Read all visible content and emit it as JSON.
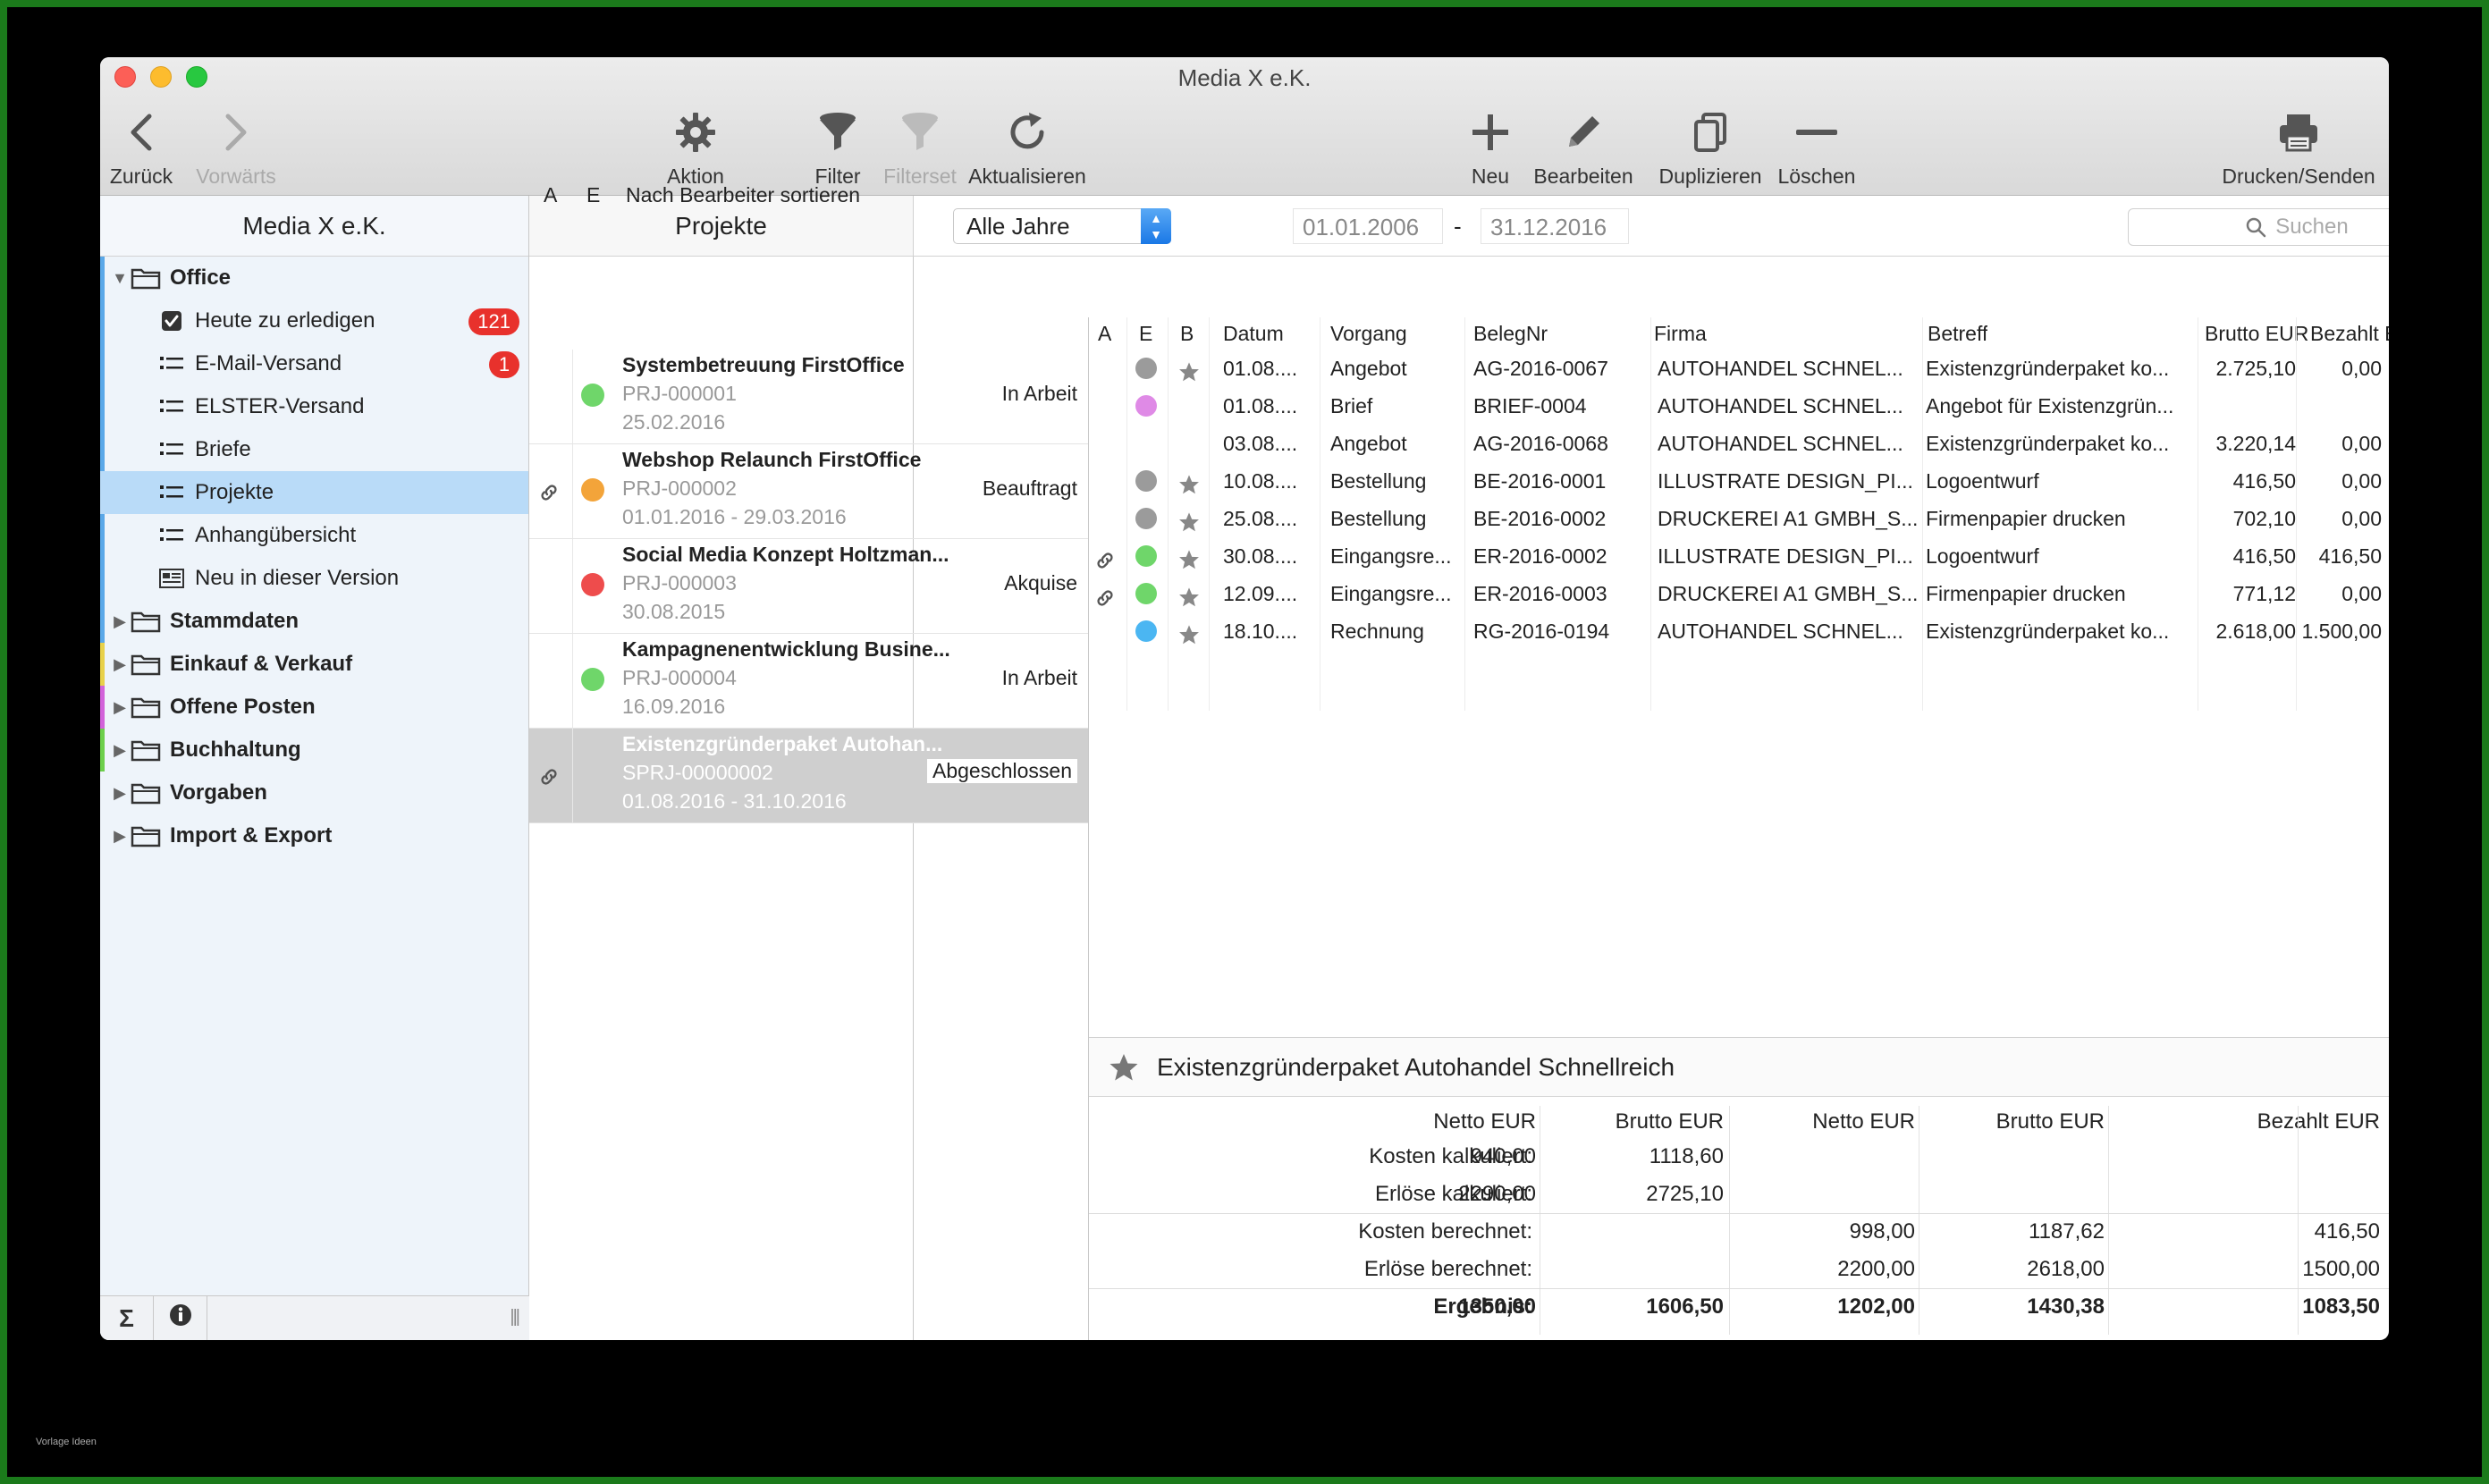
{
  "window": {
    "title": "Media X e.K."
  },
  "toolbar": {
    "back": "Zurück",
    "forward": "Vorwärts",
    "action": "Aktion",
    "filter": "Filter",
    "filterset": "Filterset",
    "refresh": "Aktualisieren",
    "new": "Neu",
    "edit": "Bearbeiten",
    "duplicate": "Duplizieren",
    "delete": "Löschen",
    "print": "Drucken/Senden"
  },
  "sidebar": {
    "title": "Media X e.K.",
    "office_label": "Office",
    "office_children": [
      {
        "label": "Heute zu erledigen",
        "icon": "checkbox-icon",
        "badge": "121"
      },
      {
        "label": "E-Mail-Versand",
        "icon": "list-icon",
        "badge": "1"
      },
      {
        "label": "ELSTER-Versand",
        "icon": "list-icon",
        "badge": ""
      },
      {
        "label": "Briefe",
        "icon": "list-icon",
        "badge": ""
      },
      {
        "label": "Projekte",
        "icon": "list-icon",
        "badge": ""
      },
      {
        "label": "Anhangübersicht",
        "icon": "list-icon",
        "badge": ""
      },
      {
        "label": "Neu in dieser Version",
        "icon": "newsletter-icon",
        "badge": ""
      }
    ],
    "folders": [
      {
        "label": "Stammdaten",
        "color": "#5aa8e8"
      },
      {
        "label": "Einkauf & Verkauf",
        "color": "#e8d14a"
      },
      {
        "label": "Offene Posten",
        "color": "#d262d9"
      },
      {
        "label": "Buchhaltung",
        "color": "#6ccf4b"
      },
      {
        "label": "Vorgaben",
        "color": ""
      },
      {
        "label": "Import & Export",
        "color": ""
      }
    ],
    "office_color": "#5aa8e8",
    "selected_color": "#b9dbf8"
  },
  "projects": {
    "title": "Projekte",
    "col_a": "A",
    "col_e": "E",
    "col_sort": "Nach Bearbeiter sortieren",
    "items": [
      {
        "name": "Systembetreuung FirstOffice",
        "number": "PRJ-000001",
        "status": "In Arbeit",
        "date": "25.02.2016",
        "color": "#6fd66a",
        "link": false
      },
      {
        "name": "Webshop Relaunch FirstOffice",
        "number": "PRJ-000002",
        "status": "Beauftragt",
        "date": "01.01.2016 - 29.03.2016",
        "color": "#f3a43a",
        "link": true
      },
      {
        "name": "Social Media Konzept Holtzman...",
        "number": "PRJ-000003",
        "status": "Akquise",
        "date": "30.08.2015",
        "color": "#ee4c4c",
        "link": false
      },
      {
        "name": "Kampagnenentwicklung Busine...",
        "number": "PRJ-000004",
        "status": "In Arbeit",
        "date": "16.09.2016",
        "color": "#6fd66a",
        "link": false
      },
      {
        "name": "Existenzgründerpaket Autohan...",
        "number": "SPRJ-00000002",
        "status": "Abgeschlossen",
        "date": "01.08.2016 - 31.10.2016",
        "color": "",
        "link": true
      }
    ]
  },
  "filter": {
    "year": "Alle Jahre",
    "date_from": "01.01.2006",
    "date_sep": "-",
    "date_to": "31.12.2016",
    "search_placeholder": "Suchen"
  },
  "vorgaenge": {
    "headers": {
      "a": "A",
      "e": "E",
      "b": "B",
      "datum": "Datum",
      "vorgang": "Vorgang",
      "belegnr": "BelegNr",
      "firma": "Firma",
      "betreff": "Betreff",
      "brutto": "Brutto EUR",
      "bezahlt": "Bezahlt EUR"
    },
    "rows": [
      {
        "link": false,
        "dot": "#9b9b9b",
        "star": true,
        "datum": "01.08....",
        "vorgang": "Angebot",
        "belegnr": "AG-2016-0067",
        "firma": "AUTOHANDEL SCHNEL...",
        "betreff": "Existenzgründerpaket ko...",
        "brutto": "2.725,10",
        "bezahlt": "0,00"
      },
      {
        "link": false,
        "dot": "#df8ae6",
        "star": false,
        "datum": "01.08....",
        "vorgang": "Brief",
        "belegnr": "BRIEF-0004",
        "firma": "AUTOHANDEL SCHNEL...",
        "betreff": "Angebot für Existenzgrün...",
        "brutto": "",
        "bezahlt": ""
      },
      {
        "link": false,
        "dot": "",
        "star": false,
        "datum": "03.08....",
        "vorgang": "Angebot",
        "belegnr": "AG-2016-0068",
        "firma": "AUTOHANDEL SCHNEL...",
        "betreff": "Existenzgründerpaket ko...",
        "brutto": "3.220,14",
        "bezahlt": "0,00"
      },
      {
        "link": false,
        "dot": "#9b9b9b",
        "star": true,
        "datum": "10.08....",
        "vorgang": "Bestellung",
        "belegnr": "BE-2016-0001",
        "firma": "ILLUSTRATE DESIGN_PI...",
        "betreff": "Logoentwurf",
        "brutto": "416,50",
        "bezahlt": "0,00"
      },
      {
        "link": false,
        "dot": "#9b9b9b",
        "star": true,
        "datum": "25.08....",
        "vorgang": "Bestellung",
        "belegnr": "BE-2016-0002",
        "firma": "DRUCKEREI A1 GMBH_S...",
        "betreff": "Firmenpapier drucken",
        "brutto": "702,10",
        "bezahlt": "0,00"
      },
      {
        "link": true,
        "dot": "#6fd66a",
        "star": true,
        "datum": "30.08....",
        "vorgang": "Eingangsre...",
        "belegnr": "ER-2016-0002",
        "firma": "ILLUSTRATE DESIGN_PI...",
        "betreff": "Logoentwurf",
        "brutto": "416,50",
        "bezahlt": "416,50"
      },
      {
        "link": true,
        "dot": "#6fd66a",
        "star": true,
        "datum": "12.09....",
        "vorgang": "Eingangsre...",
        "belegnr": "ER-2016-0003",
        "firma": "DRUCKEREI A1 GMBH_S...",
        "betreff": "Firmenpapier drucken",
        "brutto": "771,12",
        "bezahlt": "0,00"
      },
      {
        "link": false,
        "dot": "#4bb6f2",
        "star": true,
        "datum": "18.10....",
        "vorgang": "Rechnung",
        "belegnr": "RG-2016-0194",
        "firma": "AUTOHANDEL SCHNEL...",
        "betreff": "Existenzgründerpaket ko...",
        "brutto": "2.618,00",
        "bezahlt": "1.500,00"
      }
    ]
  },
  "detail": {
    "title": "Existenzgründerpaket Autohandel Schnellreich",
    "headers": [
      "Netto EUR",
      "Brutto EUR",
      "Netto EUR",
      "Brutto EUR",
      "Bezahlt EUR"
    ],
    "rows": [
      {
        "label": "Kosten kalkuliert:",
        "v": [
          "940,00",
          "1118,60",
          "",
          "",
          ""
        ]
      },
      {
        "label": "Erlöse kalkuliert:",
        "v": [
          "2290,00",
          "2725,10",
          "",
          "",
          ""
        ]
      },
      {
        "label": "Kosten berechnet:",
        "v": [
          "",
          "",
          "998,00",
          "1187,62",
          "416,50"
        ]
      },
      {
        "label": "Erlöse berechnet:",
        "v": [
          "",
          "",
          "2200,00",
          "2618,00",
          "1500,00"
        ]
      },
      {
        "label": "Ergebnis:",
        "v": [
          "1350,00",
          "1606,50",
          "1202,00",
          "1430,38",
          "1083,50"
        ]
      }
    ]
  },
  "watermark": "Vorlage Ideen"
}
